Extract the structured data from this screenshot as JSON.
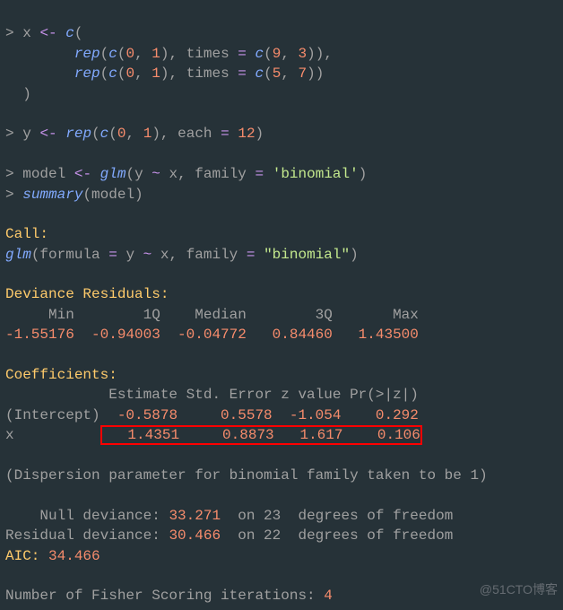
{
  "code": {
    "l1_prompt": ">",
    "l1_var": "x",
    "l1_assign": "<-",
    "l1_fn": "c",
    "l1_open": "(",
    "l2_indent": "        ",
    "l2_fn": "rep",
    "l2_open": "(",
    "l2_in_fn": "c",
    "l2_in_args": "(0, 1)",
    "l2_times_lbl": ", times ",
    "l2_times_eq": "= ",
    "l2_times_fn": "c",
    "l2_times_args": "(9, 3)),",
    "l3_indent": "        ",
    "l3_fn": "rep",
    "l3_open": "(",
    "l3_in_fn": "c",
    "l3_in_args": "(0, 1)",
    "l3_times_lbl": ", times ",
    "l3_times_eq": "= ",
    "l3_times_fn": "c",
    "l3_times_args": "(5, 7))",
    "l4_close": "  )",
    "l6_prompt": ">",
    "l6_var": "y",
    "l6_assign": "<-",
    "l6_fn": "rep",
    "l6_open": "(",
    "l6_in_fn": "c",
    "l6_in_args": "(0, 1)",
    "l6_each_lbl": ", each ",
    "l6_each_eq": "= ",
    "l6_each_val": "12",
    "l6_close": ")",
    "l8_prompt": ">",
    "l8_var": "model",
    "l8_assign": "<-",
    "l8_fn": "glm",
    "l8_args_open": "(y ",
    "l8_tilde": "~",
    "l8_args_mid": " x, family ",
    "l8_eq": "= ",
    "l8_str": "'binomial'",
    "l8_close": ")",
    "l9_prompt": ">",
    "l9_fn": "summary",
    "l9_args": "(model)"
  },
  "output": {
    "call_label": "Call:",
    "call_fn": "glm",
    "call_open": "(formula ",
    "call_eq1": "= ",
    "call_mid1": "y ",
    "call_tilde": "~",
    "call_mid2": " x, family ",
    "call_eq2": "= ",
    "call_str": "\"binomial\"",
    "call_close": ")",
    "dev_title": "Deviance Residuals: ",
    "dev_header": "     Min        1Q    Median        3Q       Max  ",
    "dev_values": "-1.55176  -0.94003  -0.04772   0.84460   1.43500  ",
    "coef_title": "Coefficients:",
    "coef_header": "            Estimate Std. Error z value Pr(>|z|)",
    "coef_intercept_label": "(Intercept)",
    "coef_intercept_vals": "  -0.5878     0.5578  -1.054    0.292",
    "coef_x_label": "x          ",
    "coef_x_vals": "   1.4351     0.8873   1.617    0.106",
    "dispersion": "(Dispersion parameter for binomial family taken to be 1)",
    "null_dev_lbl": "    Null deviance: ",
    "null_dev_val": "33.271",
    "null_dev_rest": "  on 23  degrees of freedom",
    "resid_dev_lbl": "Residual deviance: ",
    "resid_dev_val": "30.466",
    "resid_dev_rest": "  on 22  degrees of freedom",
    "aic_lbl": "AIC: ",
    "aic_val": "34.466",
    "fisher_lbl": "Number of Fisher Scoring iterations: ",
    "fisher_val": "4"
  },
  "watermark": "@51CTO博客"
}
